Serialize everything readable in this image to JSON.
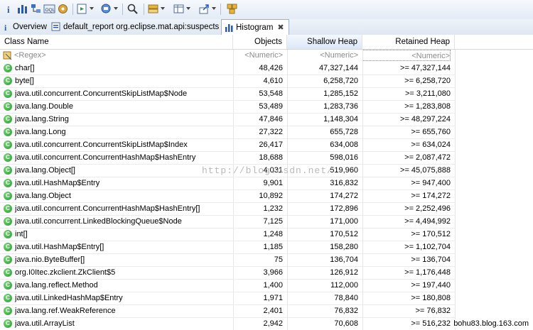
{
  "toolbar": {
    "icons": [
      "info-icon",
      "histogram-icon",
      "dominator-tree-icon",
      "oql-icon",
      "thread-icon",
      "run-report-icon",
      "query-browser-icon",
      "search-icon",
      "group-by-icon",
      "columns-icon",
      "export-icon",
      "leak-suspects-icon"
    ]
  },
  "tabs": [
    {
      "label": "Overview",
      "icon": "info-icon"
    },
    {
      "label": "default_report  org.eclipse.mat.api:suspects",
      "icon": "report-icon"
    },
    {
      "label": "Histogram",
      "icon": "histogram-icon",
      "active": true,
      "close": "✖"
    }
  ],
  "table": {
    "columns": [
      "Class Name",
      "Objects",
      "Shallow Heap",
      "Retained Heap"
    ],
    "filters": [
      "<Regex>",
      "<Numeric>",
      "<Numeric>",
      "<Numeric>"
    ],
    "rows": [
      [
        "char[]",
        "48,426",
        "47,327,144",
        ">= 47,327,144"
      ],
      [
        "byte[]",
        "4,610",
        "6,258,720",
        ">= 6,258,720"
      ],
      [
        "java.util.concurrent.ConcurrentSkipListMap$Node",
        "53,548",
        "1,285,152",
        ">= 3,211,080"
      ],
      [
        "java.lang.Double",
        "53,489",
        "1,283,736",
        ">= 1,283,808"
      ],
      [
        "java.lang.String",
        "47,846",
        "1,148,304",
        ">= 48,297,224"
      ],
      [
        "java.lang.Long",
        "27,322",
        "655,728",
        ">= 655,760"
      ],
      [
        "java.util.concurrent.ConcurrentSkipListMap$Index",
        "26,417",
        "634,008",
        ">= 634,024"
      ],
      [
        "java.util.concurrent.ConcurrentHashMap$HashEntry",
        "18,688",
        "598,016",
        ">= 2,087,472"
      ],
      [
        "java.lang.Object[]",
        "4,031",
        "519,960",
        ">= 45,075,888"
      ],
      [
        "java.util.HashMap$Entry",
        "9,901",
        "316,832",
        ">= 947,400"
      ],
      [
        "java.lang.Object",
        "10,892",
        "174,272",
        ">= 174,272"
      ],
      [
        "java.util.concurrent.ConcurrentHashMap$HashEntry[]",
        "1,232",
        "172,896",
        ">= 2,252,496"
      ],
      [
        "java.util.concurrent.LinkedBlockingQueue$Node",
        "7,125",
        "171,000",
        ">= 4,494,992"
      ],
      [
        "int[]",
        "1,248",
        "170,512",
        ">= 170,512"
      ],
      [
        "java.util.HashMap$Entry[]",
        "1,185",
        "158,280",
        ">= 1,102,704"
      ],
      [
        "java.nio.ByteBuffer[]",
        "75",
        "136,704",
        ">= 136,704"
      ],
      [
        "org.I0Itec.zkclient.ZkClient$5",
        "3,966",
        "126,912",
        ">= 1,176,448"
      ],
      [
        "java.lang.reflect.Method",
        "1,400",
        "112,000",
        ">= 197,440"
      ],
      [
        "java.util.LinkedHashMap$Entry",
        "1,971",
        "78,840",
        ">= 180,808"
      ],
      [
        "java.lang.ref.WeakReference",
        "2,401",
        "76,832",
        ">= 76,832"
      ],
      [
        "java.util.ArrayList",
        "2,942",
        "70,608",
        ">= 516,232"
      ]
    ]
  },
  "watermark": "http://blog.csdn.net/",
  "credit": "bohu83.blog.163.com"
}
